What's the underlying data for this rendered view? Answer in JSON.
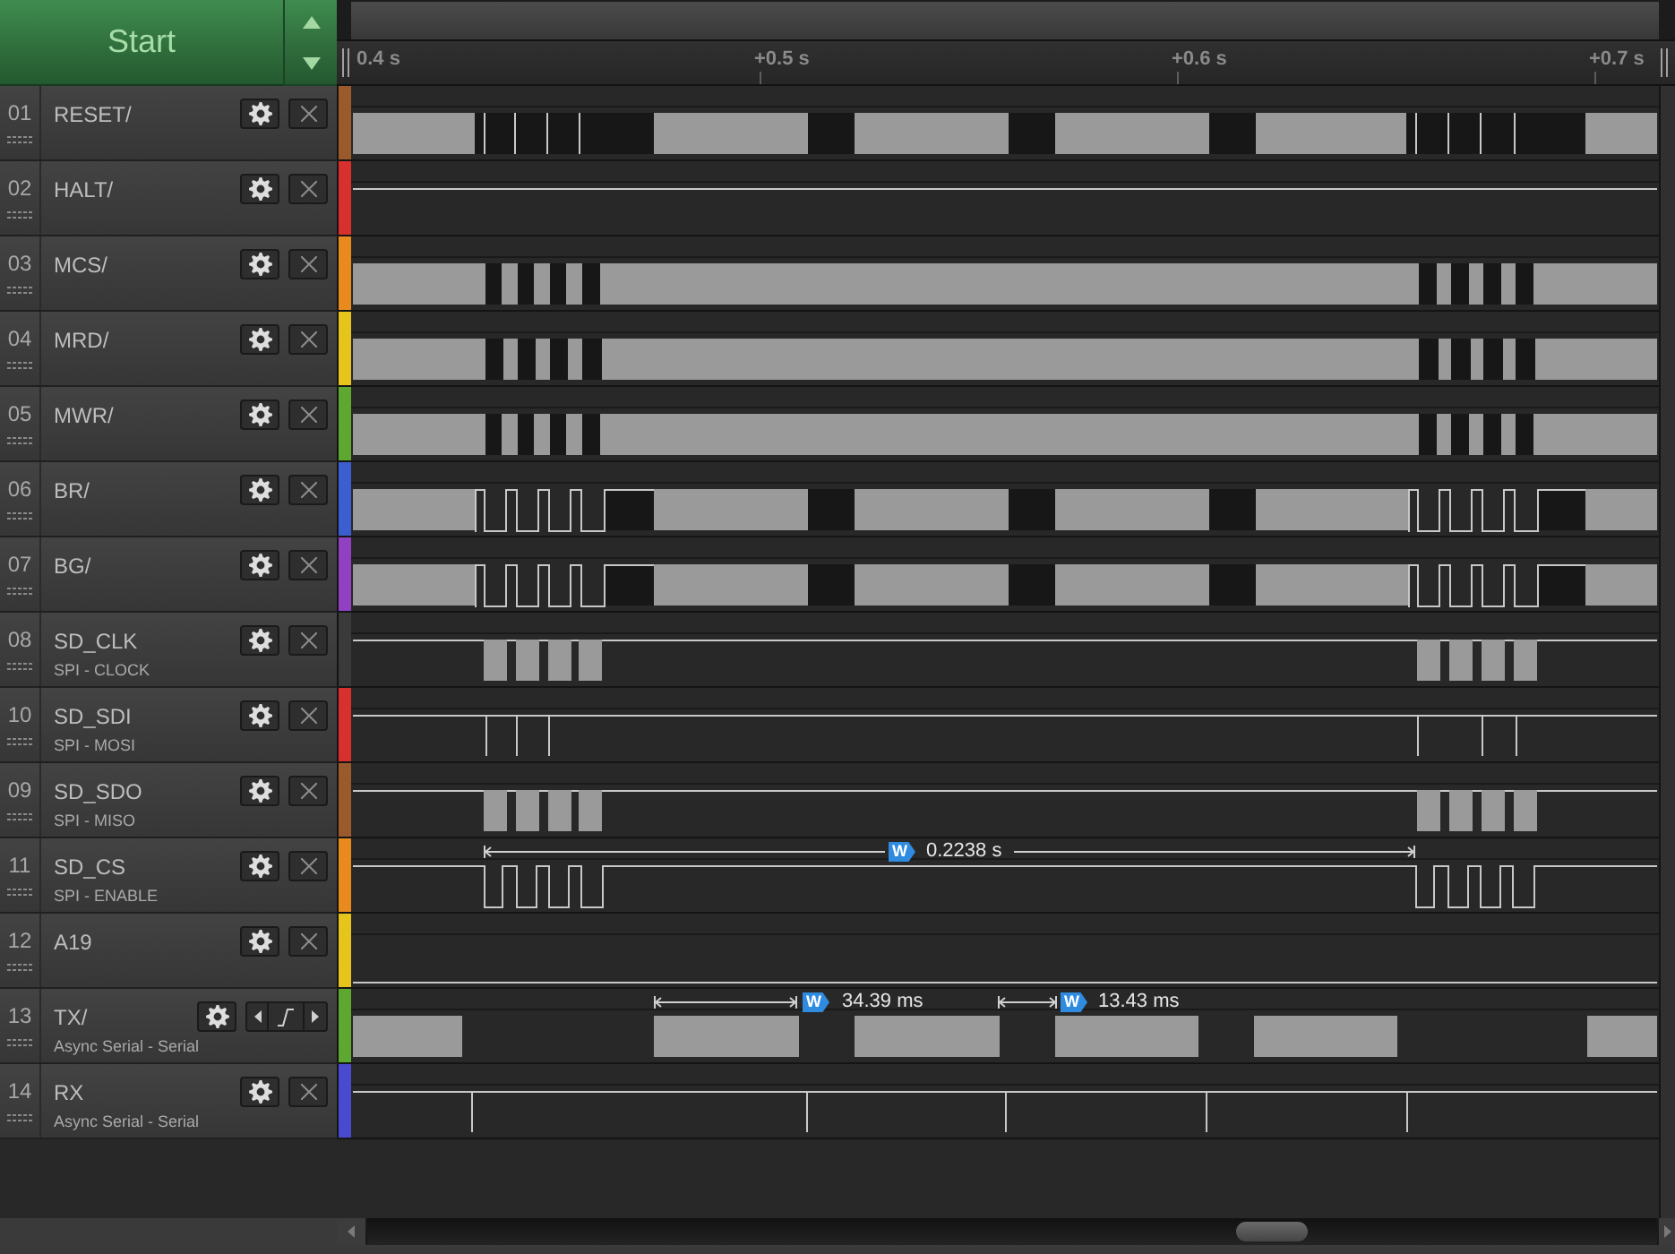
{
  "start_button": {
    "label": "Start"
  },
  "timeline": {
    "ticks": [
      "0.4 s",
      "+0.5 s",
      "+0.6 s",
      "+0.7 s"
    ]
  },
  "channels": [
    {
      "number": "01",
      "name": "RESET/",
      "color": "#9b5a2c",
      "hovered": false
    },
    {
      "number": "02",
      "name": "HALT/",
      "color": "#d8302c",
      "hovered": false
    },
    {
      "number": "03",
      "name": "MCS/",
      "color": "#e98a1e",
      "hovered": false
    },
    {
      "number": "04",
      "name": "MRD/",
      "color": "#e5c51c",
      "hovered": false
    },
    {
      "number": "05",
      "name": "MWR/",
      "color": "#5ea832",
      "hovered": false
    },
    {
      "number": "06",
      "name": "BR/",
      "color": "#3b5fd0",
      "hovered": false
    },
    {
      "number": "07",
      "name": "BG/",
      "color": "#9040c0",
      "hovered": false
    },
    {
      "number": "08",
      "name": "SD_CLK",
      "analyzer": "SPI - CLOCK",
      "color": "#3a3a3a",
      "hovered": false
    },
    {
      "number": "10",
      "name": "SD_SDI",
      "analyzer": "SPI - MOSI",
      "color": "#d8302c",
      "hovered": false
    },
    {
      "number": "09",
      "name": "SD_SDO",
      "analyzer": "SPI - MISO",
      "color": "#9b5a2c",
      "hovered": false
    },
    {
      "number": "11",
      "name": "SD_CS",
      "analyzer": "SPI - ENABLE",
      "color": "#e98a1e",
      "hovered": false,
      "measurements": [
        {
          "badge": "W",
          "value": "0.2238 s"
        }
      ]
    },
    {
      "number": "12",
      "name": "A19",
      "color": "#e5c51c",
      "hovered": false
    },
    {
      "number": "13",
      "name": "TX/",
      "analyzer": "Async Serial - Serial",
      "color": "#5ea832",
      "hovered": true,
      "measurements": [
        {
          "badge": "W",
          "value": "34.39 ms"
        },
        {
          "badge": "W",
          "value": "13.43 ms"
        }
      ]
    },
    {
      "number": "14",
      "name": "RX",
      "analyzer": "Async Serial - Serial",
      "color": "#4a4ad0",
      "hovered": false
    }
  ]
}
